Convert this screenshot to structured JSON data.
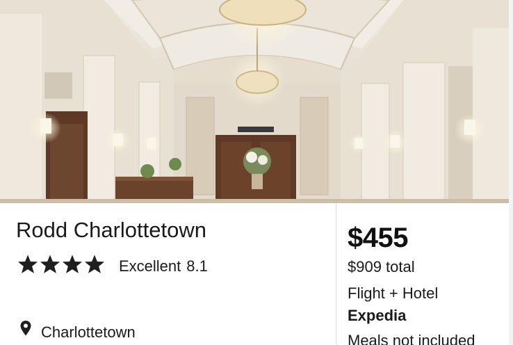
{
  "listing": {
    "photo_icon": "hotel-lobby-photo",
    "name": "Rodd Charlottetown",
    "stars": 4,
    "rating_label": "Excellent",
    "rating_score": "8.1",
    "location": "Charlottetown",
    "location_icon": "map-pin-icon"
  },
  "pricing": {
    "price": "$455",
    "total": "$909 total",
    "package": "Flight + Hotel",
    "provider": "Expedia",
    "meals": "Meals not included"
  },
  "colors": {
    "text": "#1a1a1a",
    "divider": "#dcdcdc",
    "wall": "#e9e2d6",
    "wood": "#5e3a26"
  }
}
